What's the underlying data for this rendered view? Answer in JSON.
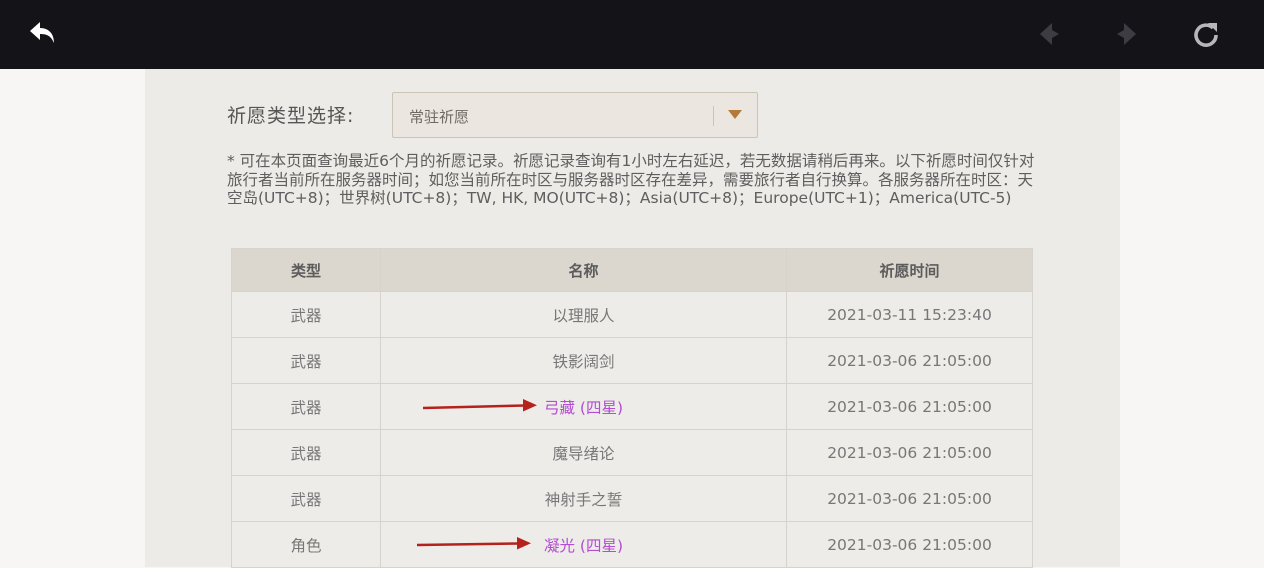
{
  "toolbar": {
    "back_icon": "back-arrow-icon",
    "prev_icon": "prev-page-icon",
    "next_icon": "next-page-icon",
    "reload_icon": "reload-icon",
    "background_color": "#131318"
  },
  "filter": {
    "label": "祈愿类型选择:",
    "selected": "常驻祈愿",
    "arrow_icon": "chevron-down-icon"
  },
  "notice": "* 可在本页面查询最近6个月的祈愿记录。祈愿记录查询有1小时左右延迟，若无数据请稍后再来。以下祈愿时间仅针对旅行者当前所在服务器时间；如您当前所在时区与服务器时区存在差异，需要旅行者自行换算。各服务器所在时区：天空岛(UTC+8)；世界树(UTC+8)；TW, HK, MO(UTC+8)；Asia(UTC+8)；Europe(UTC+1)；America(UTC-5)",
  "table": {
    "headers": [
      "类型",
      "名称",
      "祈愿时间"
    ],
    "rows": [
      {
        "type": "武器",
        "name": "以理服人",
        "time": "2021-03-11 15:23:40"
      },
      {
        "type": "武器",
        "name": "铁影阔剑",
        "time": "2021-03-06 21:05:00"
      },
      {
        "type": "武器",
        "name": "弓藏 (四星)",
        "time": "2021-03-06 21:05:00"
      },
      {
        "type": "武器",
        "name": "魔导绪论",
        "time": "2021-03-06 21:05:00"
      },
      {
        "type": "武器",
        "name": "神射手之誓",
        "time": "2021-03-06 21:05:00"
      },
      {
        "type": "角色",
        "name": "凝光 (四星)",
        "time": "2021-03-06 21:05:00"
      }
    ]
  },
  "colors": {
    "four_star_text": "#b34dd1",
    "annotation_arrow": "#b5211c"
  }
}
